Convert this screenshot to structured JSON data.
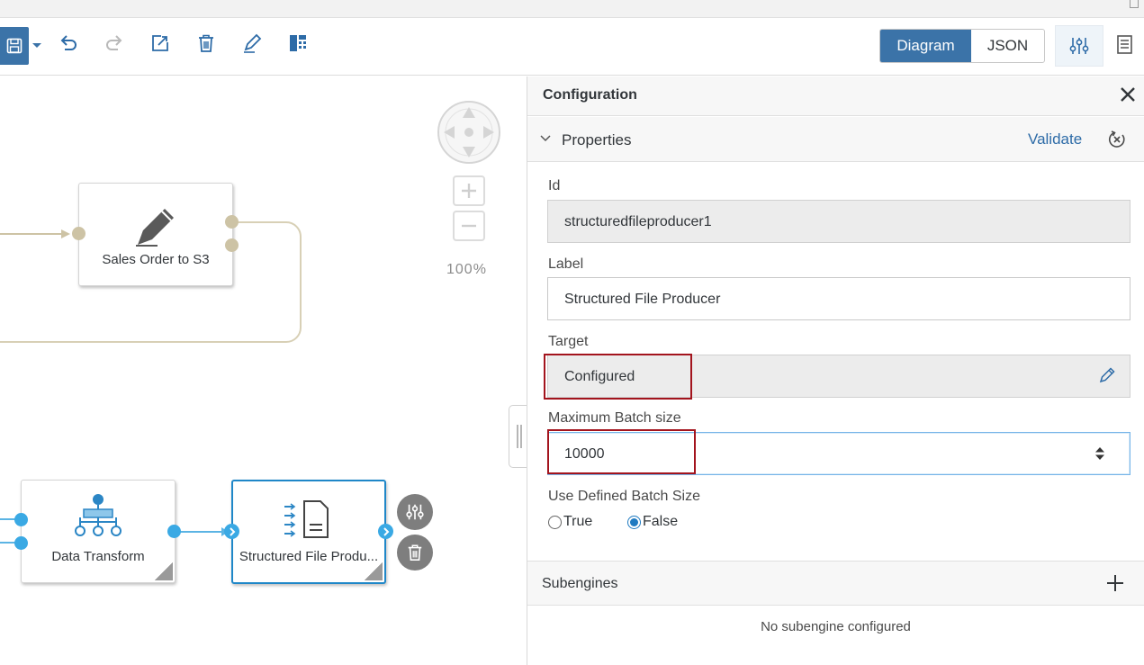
{
  "toolbar": {
    "view_toggle": {
      "diagram_label": "Diagram",
      "json_label": "JSON",
      "selected": "Diagram"
    },
    "icons": [
      "save-icon",
      "undo-icon",
      "redo-icon",
      "edit-square-icon",
      "trash-icon",
      "pencil-icon",
      "layout-icon",
      "settings-sliders-icon",
      "document-icon"
    ]
  },
  "canvas": {
    "zoom_label": "100%",
    "nodes": [
      {
        "label": "Sales Order to S3",
        "icon": "pencil-icon"
      },
      {
        "label": "Data Transform",
        "icon": "hierarchy-icon"
      },
      {
        "label": "Structured File Produ...",
        "icon": "file-producer-icon",
        "selected": true
      }
    ]
  },
  "config": {
    "title": "Configuration",
    "properties": {
      "header": "Properties",
      "validate_label": "Validate",
      "id_label": "Id",
      "id_value": "structuredfileproducer1",
      "label_label": "Label",
      "label_value": "Structured File Producer",
      "target_label": "Target",
      "target_value": "Configured",
      "max_batch_label": "Maximum Batch size",
      "max_batch_value": "10000",
      "use_defined_label": "Use Defined Batch Size",
      "radio_true": "True",
      "radio_false": "False",
      "selected": "False"
    },
    "subengines": {
      "header": "Subengines",
      "empty_text": "No subengine configured"
    }
  },
  "colors": {
    "accent": "#3b73a8",
    "selected_node_border": "#1f87c8",
    "highlight_box": "#a3141d"
  }
}
